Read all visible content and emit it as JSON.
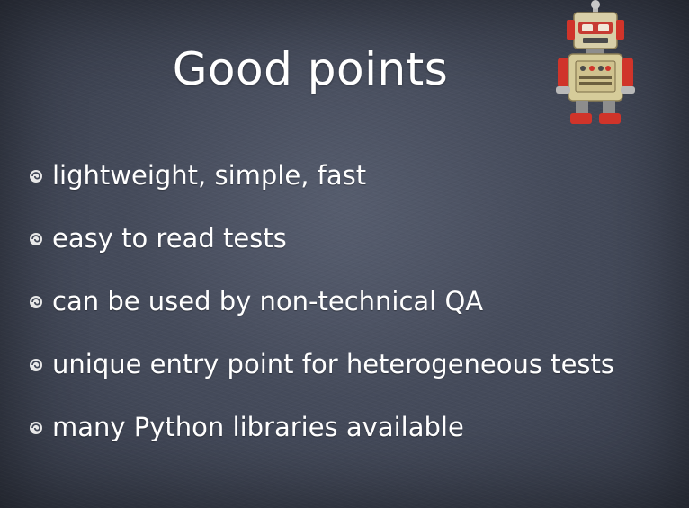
{
  "slide": {
    "title": "Good points",
    "robot_icon": "robot-icon",
    "bullet_icon": "swirl-bullet-icon",
    "bullets": [
      "lightweight, simple, fast",
      "easy to read tests",
      "can be used by non-technical QA",
      "unique entry point for heterogeneous tests",
      "many Python libraries available"
    ]
  },
  "colors": {
    "background": "#434959",
    "text": "#ffffff"
  }
}
